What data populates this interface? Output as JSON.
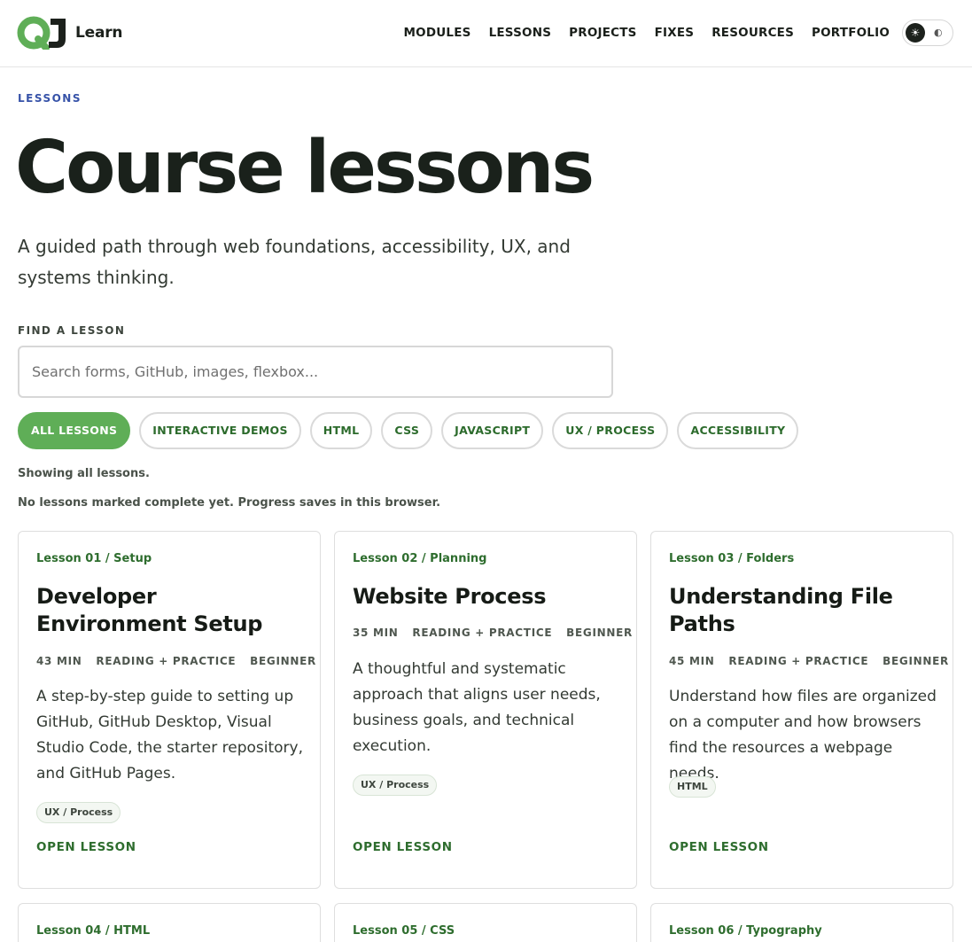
{
  "header": {
    "logo_text": "Learn",
    "nav": [
      {
        "label": "MODULES"
      },
      {
        "label": "LESSONS"
      },
      {
        "label": "PROJECTS"
      },
      {
        "label": "FIXES"
      },
      {
        "label": "RESOURCES"
      },
      {
        "label": "PORTFOLIO"
      }
    ],
    "theme_toggle": {
      "light_icon": "☀",
      "dark_icon": "◐"
    }
  },
  "intro": {
    "eyebrow": "LESSONS",
    "title": "Course lessons",
    "lede": "A guided path through web foundations, accessibility, UX, and systems thinking."
  },
  "search": {
    "label": "FIND A LESSON",
    "placeholder": "Search forms, GitHub, images, flexbox...",
    "value": ""
  },
  "filters": [
    {
      "label": "ALL LESSONS",
      "active": true
    },
    {
      "label": "INTERACTIVE DEMOS",
      "active": false
    },
    {
      "label": "HTML",
      "active": false
    },
    {
      "label": "CSS",
      "active": false
    },
    {
      "label": "JAVASCRIPT",
      "active": false
    },
    {
      "label": "UX / PROCESS",
      "active": false
    },
    {
      "label": "ACCESSIBILITY",
      "active": false
    }
  ],
  "status": {
    "showing": "Showing all lessons.",
    "progress": "No lessons marked complete yet. Progress saves in this browser."
  },
  "colors": {
    "accent_green": "#5fae57",
    "link_green": "#2e6d2e",
    "eyebrow_blue": "#3652a8",
    "logo_green": "#5fae57",
    "logo_dark": "#1c211c"
  },
  "lessons": [
    {
      "meta": "Lesson 01 / Setup",
      "title": "Developer Environment Setup",
      "facts": [
        "43 MIN",
        "READING + PRACTICE",
        "BEGINNER"
      ],
      "description": "A step-by-step guide to setting up GitHub, GitHub Desktop, Visual Studio Code, the starter repository, and GitHub Pages.",
      "tag": "UX / Process",
      "cta": "OPEN LESSON"
    },
    {
      "meta": "Lesson 02 / Planning",
      "title": "Website Process",
      "facts": [
        "35 MIN",
        "READING + PRACTICE",
        "BEGINNER"
      ],
      "description": "A thoughtful and systematic approach that aligns user needs, business goals, and technical execution.",
      "tag": "UX / Process",
      "cta": "OPEN LESSON"
    },
    {
      "meta": "Lesson 03 / Folders",
      "title": "Understanding File Paths",
      "facts": [
        "45 MIN",
        "READING + PRACTICE",
        "BEGINNER"
      ],
      "description": "Understand how files are organized on a computer and how browsers find the resources a webpage needs.",
      "tag": "HTML",
      "cta": "OPEN LESSON"
    },
    {
      "meta": "Lesson 04 / HTML"
    },
    {
      "meta": "Lesson 05 / CSS"
    },
    {
      "meta": "Lesson 06 / Typography"
    }
  ]
}
